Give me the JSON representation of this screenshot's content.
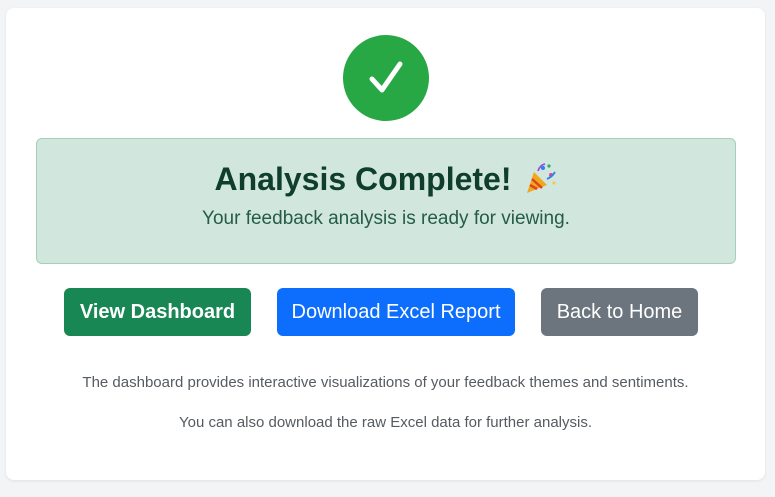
{
  "status": {
    "icon": "checkmark-icon",
    "color": "#28a745"
  },
  "alert": {
    "title": "Analysis Complete!",
    "title_icon": "party-popper-icon",
    "subtitle": "Your feedback analysis is ready for viewing.",
    "background": "#d1e7dd"
  },
  "actions": {
    "view_dashboard": "View Dashboard",
    "download_report": "Download Excel Report",
    "back_home": "Back to Home"
  },
  "colors": {
    "success": "#198754",
    "primary": "#0d6efd",
    "secondary": "#6c757d"
  },
  "info": {
    "line1": "The dashboard provides interactive visualizations of your feedback themes and sentiments.",
    "line2": "You can also download the raw Excel data for further analysis."
  }
}
